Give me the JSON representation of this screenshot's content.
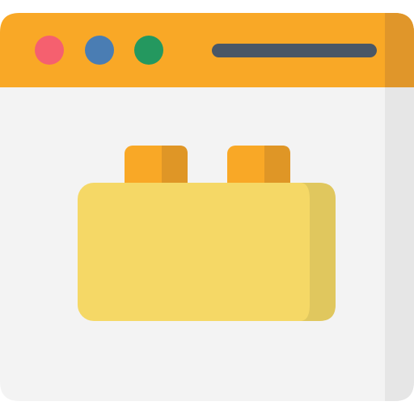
{
  "icon": {
    "kind": "browser-window-with-building-block",
    "colors": {
      "title_bar": "#F9A826",
      "title_bar_shade": "#E0962A",
      "window_body": "#F3F3F3",
      "window_body_shade": "#E6E6E6",
      "dot_red": "#F5606F",
      "dot_blue": "#4A7DB3",
      "dot_green": "#24985F",
      "address_bar": "#4A5766",
      "block_body": "#F5D866",
      "block_body_shade": "#E0C75E",
      "block_stud": "#F9A826",
      "block_stud_shade": "#DF9626"
    },
    "window_controls": [
      "close-dot",
      "minimize-dot",
      "maximize-dot"
    ]
  }
}
